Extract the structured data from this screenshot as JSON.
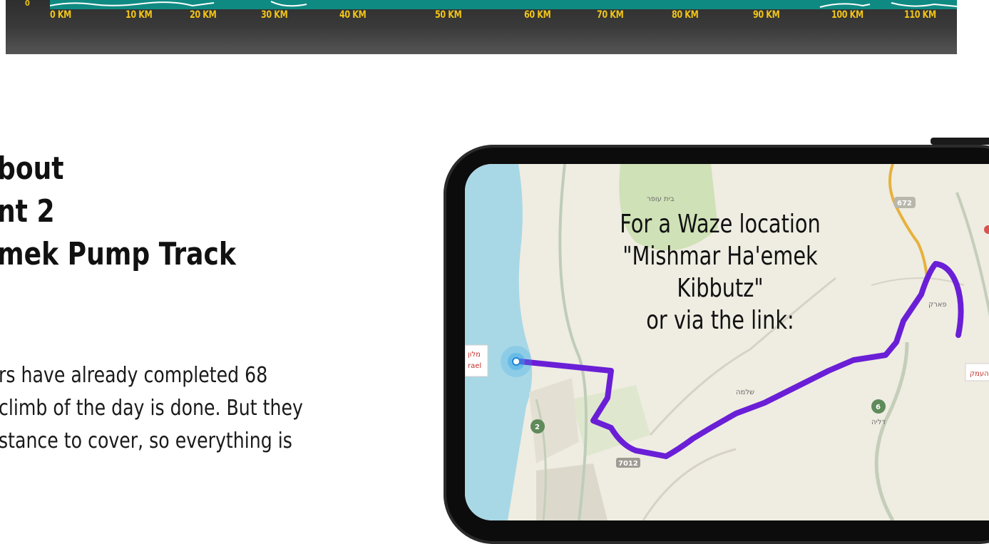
{
  "elevation_banner": {
    "zero_label": "0",
    "km_labels": [
      "0 KM",
      "10 KM",
      "20 KM",
      "30 KM",
      "40 KM",
      "50 KM",
      "60 KM",
      "70 KM",
      "80 KM",
      "90 KM",
      "100 KM",
      "110 KM"
    ],
    "colors": {
      "strip": "#0f8a82",
      "labels": "#f0c419",
      "background": "#3a3a3a"
    }
  },
  "section": {
    "heading_lines": [
      "bout",
      "nt 2",
      "mek Pump Track"
    ],
    "body_lines": [
      "rs have already completed 68",
      "climb of the day is done. But they",
      "stance to cover, so everything is"
    ]
  },
  "phone": {
    "overlay_lines": [
      "For a Waze location",
      "\"Mishmar Ha'emek",
      "Kibbutz\"",
      "or via the link:"
    ],
    "map": {
      "route_color": "#6a1fd6",
      "road_shields": [
        "672",
        "6",
        "2",
        "7012"
      ],
      "place_labels": [
        "מלון",
        "rael",
        "העמק",
        "פארק",
        "דליה",
        "שלמה",
        "בית עופר"
      ]
    }
  }
}
